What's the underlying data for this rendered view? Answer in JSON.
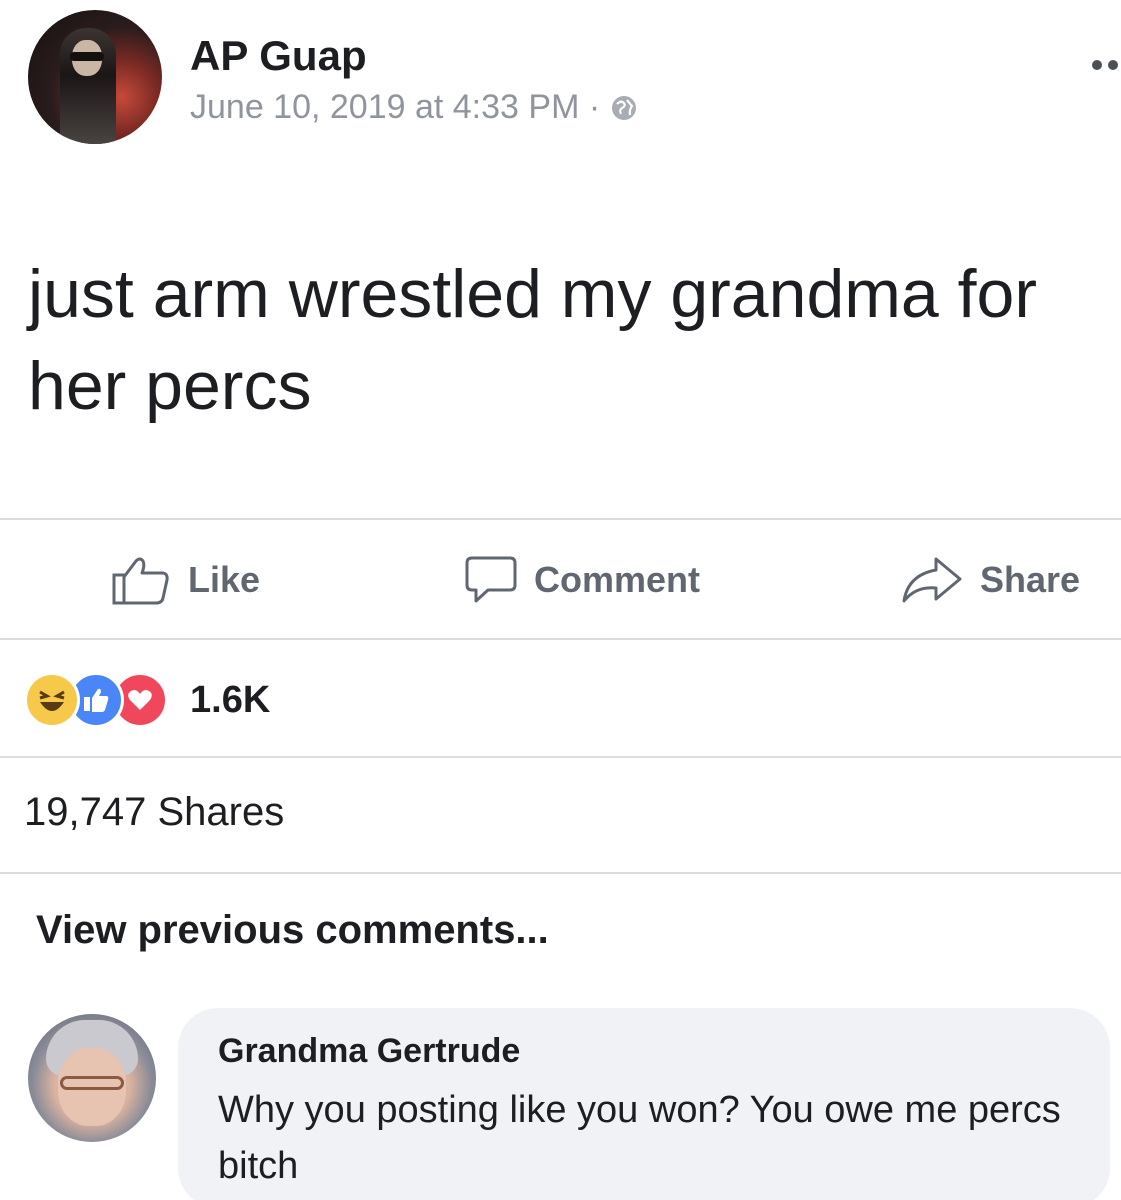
{
  "post": {
    "author": "AP Guap",
    "timestamp": "June 10, 2019 at 4:33 PM ·",
    "privacy_icon": "globe-icon",
    "text": "just arm wrestled my grandma for her percs"
  },
  "actions": {
    "like_label": "Like",
    "comment_label": "Comment",
    "share_label": "Share"
  },
  "engagement": {
    "reaction_icons": [
      "haha-reaction-icon",
      "like-reaction-icon",
      "love-reaction-icon"
    ],
    "reaction_count": "1.6K",
    "shares": "19,747 Shares"
  },
  "comments": {
    "view_previous_label": "View previous comments...",
    "items": [
      {
        "author": "Grandma Gertrude",
        "text": "Why you posting like you won? You owe me percs bitch"
      }
    ]
  },
  "colors": {
    "text": "#1c1e21",
    "meta": "#90949c",
    "action": "#606770",
    "divider": "#dadde1",
    "bubble": "#f0f2f5",
    "like_blue": "#4a86f7",
    "love_red": "#f0475c",
    "haha_yellow": "#f7c94a"
  }
}
